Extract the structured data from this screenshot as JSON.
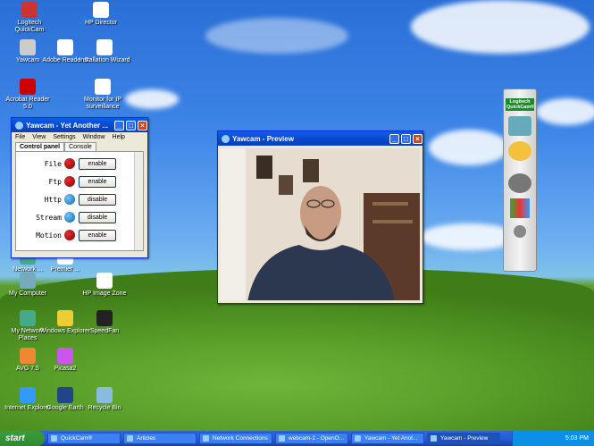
{
  "desktop_icons": [
    {
      "label": "Logitech QuickCam",
      "color": "#c33"
    },
    {
      "label": "HP Director",
      "color": "#fff"
    },
    {
      "label": "Yawcam",
      "color": "#ccc"
    },
    {
      "label": "Adobe Reader 8",
      "color": "#fff"
    },
    {
      "label": "Installation Wizard",
      "color": "#fff"
    },
    {
      "label": "Acrobat Reader 5.0",
      "color": "#c00"
    },
    {
      "label": "Monitor for IP surveillance",
      "color": "#fff"
    },
    {
      "label": "My Computer",
      "color": "#7ab"
    },
    {
      "label": "HP Image Zone",
      "color": "#fff"
    },
    {
      "label": "My Network Places",
      "color": "#4a8"
    },
    {
      "label": "Windows Explorer",
      "color": "#ec3"
    },
    {
      "label": "SpeedFan",
      "color": "#222"
    },
    {
      "label": "AVG 7.5",
      "color": "#e83"
    },
    {
      "label": "Picasa2",
      "color": "#c5e"
    },
    {
      "label": "Internet Explorer",
      "color": "#39f"
    },
    {
      "label": "Google Earth",
      "color": "#248"
    },
    {
      "label": "Recycle Bin",
      "color": "#8bd"
    },
    {
      "label": "Network ...",
      "color": "#4a8"
    },
    {
      "label": "Premier ...",
      "color": "#fff"
    }
  ],
  "yawcam_window": {
    "title": "Yawcam - Yet Another ...",
    "menu": [
      "File",
      "View",
      "Settings",
      "Window",
      "Help"
    ],
    "tabs": [
      "Control panel",
      "Console"
    ],
    "rows": [
      {
        "label": "File",
        "status": "red",
        "button": "enable"
      },
      {
        "label": "Ftp",
        "status": "red",
        "button": "enable"
      },
      {
        "label": "Http",
        "status": "globe",
        "button": "disable"
      },
      {
        "label": "Stream",
        "status": "globe",
        "button": "disable"
      },
      {
        "label": "Motion",
        "status": "red",
        "button": "enable"
      }
    ]
  },
  "preview_window": {
    "title": "Yawcam - Preview"
  },
  "logitech_panel": {
    "title": "Logitech QuickCam®"
  },
  "taskbar": {
    "start_label": "start",
    "items": [
      "QuickCam®",
      "Articles",
      "Network Connections",
      "webcam-1 - OpenO...",
      "Yawcam - Yet Anot...",
      "Yawcam - Preview"
    ],
    "active_index": 5,
    "clock": "5:03 PM"
  }
}
